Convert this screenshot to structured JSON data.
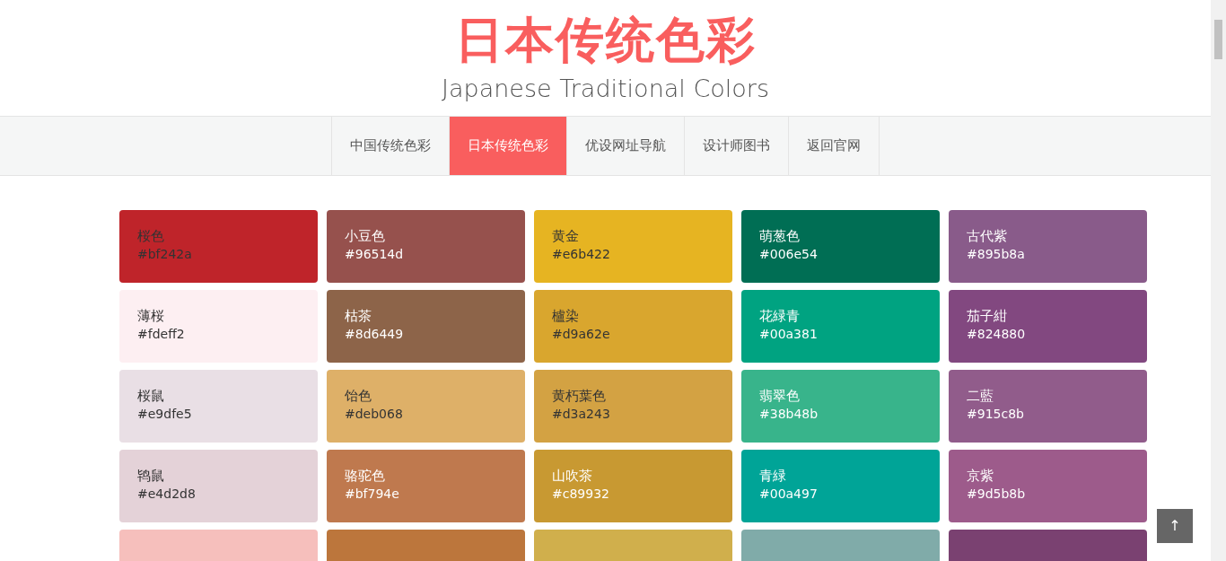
{
  "header": {
    "title": "日本传统色彩",
    "subtitle": "Japanese Traditional Colors"
  },
  "nav": [
    {
      "label": "中国传统色彩",
      "selected": false
    },
    {
      "label": "日本传统色彩",
      "selected": true
    },
    {
      "label": "优设网址导航",
      "selected": false
    },
    {
      "label": "设计师图书",
      "selected": false
    },
    {
      "label": "返回官网",
      "selected": false
    }
  ],
  "colors": [
    {
      "name": "桜色",
      "code": "#bf242a",
      "color": "#bf242a",
      "kind": "dark-text"
    },
    {
      "name": "小豆色",
      "code": "#96514d",
      "color": "#96514d",
      "kind": "light-text"
    },
    {
      "name": "黄金",
      "code": "#e6b422",
      "color": "#e6b422",
      "kind": "dark-text"
    },
    {
      "name": "萌葱色",
      "code": "#006e54",
      "color": "#006e54",
      "kind": "light-text"
    },
    {
      "name": "古代紫",
      "code": "#895b8a",
      "color": "#895b8a",
      "kind": "light-text"
    },
    {
      "name": "薄桜",
      "code": "#fdeff2",
      "color": "#fdeff2",
      "kind": "dark-text"
    },
    {
      "name": "枯茶",
      "code": "#8d6449",
      "color": "#8d6449",
      "kind": "light-text"
    },
    {
      "name": "櫨染",
      "code": "#d9a62e",
      "color": "#d9a62e",
      "kind": "dark-text"
    },
    {
      "name": "花緑青",
      "code": "#00a381",
      "color": "#00a381",
      "kind": "light-text"
    },
    {
      "name": "茄子紺",
      "code": "#824880",
      "color": "#824880",
      "kind": "light-text"
    },
    {
      "name": "桜鼠",
      "code": "#e9dfe5",
      "color": "#e9dfe5",
      "kind": "dark-text"
    },
    {
      "name": "饴色",
      "code": "#deb068",
      "color": "#deb068",
      "kind": "dark-text"
    },
    {
      "name": "黄朽葉色",
      "code": "#d3a243",
      "color": "#d3a243",
      "kind": "dark-text"
    },
    {
      "name": "翡翠色",
      "code": "#38b48b",
      "color": "#38b48b",
      "kind": "light-text"
    },
    {
      "name": "二藍",
      "code": "#915c8b",
      "color": "#915c8b",
      "kind": "light-text"
    },
    {
      "name": "鸨鼠",
      "code": "#e4d2d8",
      "color": "#e4d2d8",
      "kind": "dark-text"
    },
    {
      "name": "骆驼色",
      "code": "#bf794e",
      "color": "#bf794e",
      "kind": "light-text"
    },
    {
      "name": "山吹茶",
      "code": "#c89932",
      "color": "#c89932",
      "kind": "light-text"
    },
    {
      "name": "青緑",
      "code": "#00a497",
      "color": "#00a497",
      "kind": "light-text"
    },
    {
      "name": "京紫",
      "code": "#9d5b8b",
      "color": "#9d5b8b",
      "kind": "light-text"
    },
    {
      "color": "#f6bfbc",
      "kind": "dark-text"
    },
    {
      "color": "#bc763c",
      "kind": "light-text"
    },
    {
      "color": "#d0af4c",
      "kind": "dark-text"
    },
    {
      "color": "#80aba9",
      "kind": "light-text"
    },
    {
      "color": "#7a4171",
      "kind": "light-text"
    }
  ],
  "back_to_top": {
    "label": "↑"
  }
}
